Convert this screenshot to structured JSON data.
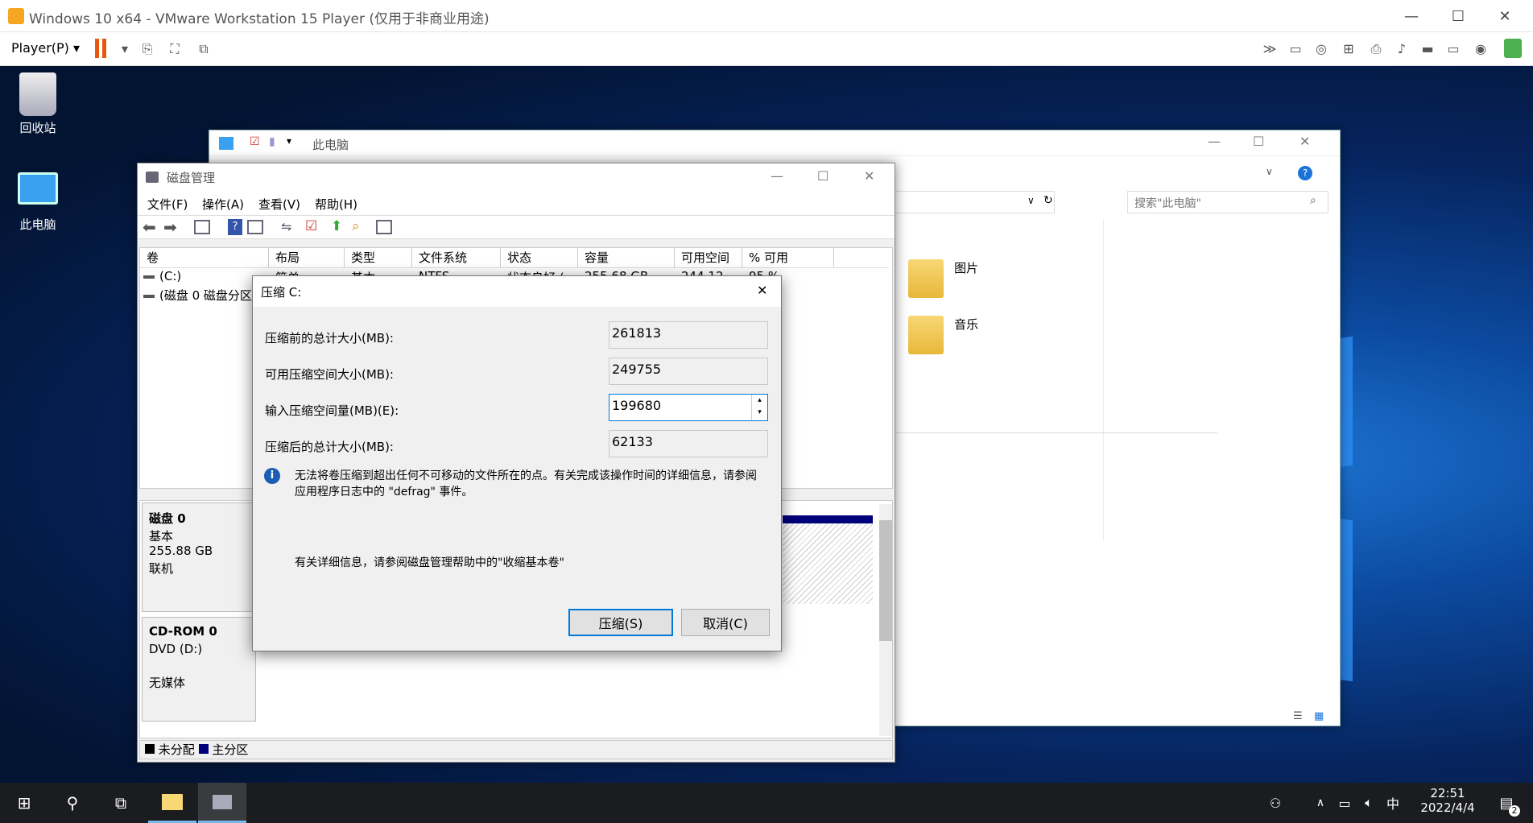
{
  "vmware": {
    "title": "Windows 10 x64 - VMware Workstation 15 Player (仅用于非商业用途)",
    "player_menu": "Player(P)"
  },
  "desktop": {
    "recycle_bin": "回收站",
    "this_pc": "此电脑"
  },
  "explorer": {
    "title": "此电脑",
    "search_placeholder": "搜索\"此电脑\"",
    "folders": [
      "图片",
      "音乐"
    ]
  },
  "diskmgmt": {
    "title": "磁盘管理",
    "menu": [
      "文件(F)",
      "操作(A)",
      "查看(V)",
      "帮助(H)"
    ],
    "columns": [
      "卷",
      "布局",
      "类型",
      "文件系统",
      "状态",
      "容量",
      "可用空间",
      "% 可用"
    ],
    "rows": [
      {
        "vol": "(C:)",
        "layout": "简单",
        "type": "基本",
        "fs": "NTFS",
        "status": "状态良好 (...",
        "cap": "255.68 GB",
        "free": "244.12 ...",
        "pct": "95 %"
      },
      {
        "vol": "(磁盘 0 磁盘分区 1)"
      }
    ],
    "disk0": {
      "name": "磁盘 0",
      "type": "基本",
      "size": "255.88 GB",
      "status": "联机"
    },
    "cdrom": {
      "name": "CD-ROM 0",
      "drive": "DVD (D:)",
      "status": "无媒体"
    },
    "legend": {
      "unallocated": "未分配",
      "primary": "主分区"
    }
  },
  "dialog": {
    "title": "压缩 C:",
    "total_before_label": "压缩前的总计大小(MB):",
    "total_before": "261813",
    "available_label": "可用压缩空间大小(MB):",
    "available": "249755",
    "input_label": "输入压缩空间量(MB)(E):",
    "input_value": "199680",
    "total_after_label": "压缩后的总计大小(MB):",
    "total_after": "62133",
    "info": "无法将卷压缩到超出任何不可移动的文件所在的点。有关完成该操作时间的详细信息，请参阅应用程序日志中的 \"defrag\" 事件。",
    "help": "有关详细信息，请参阅磁盘管理帮助中的\"收缩基本卷\"",
    "shrink_button": "压缩(S)",
    "cancel_button": "取消(C)"
  },
  "taskbar": {
    "time": "22:51",
    "date": "2022/4/4",
    "ime": "中",
    "notification_count": "2"
  }
}
